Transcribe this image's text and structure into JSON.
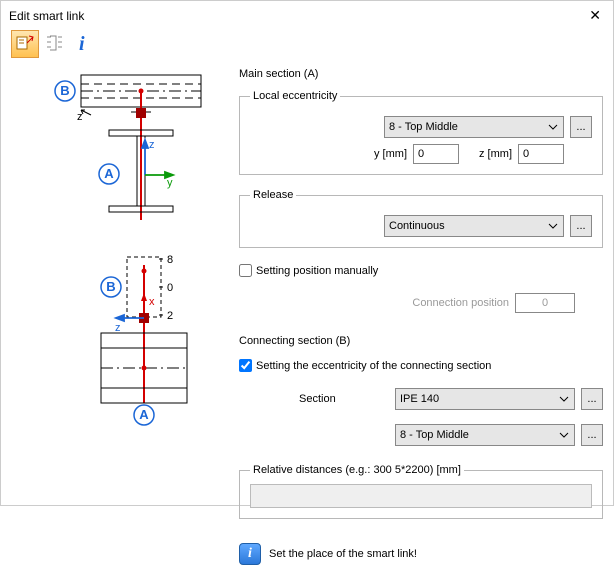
{
  "window": {
    "title": "Edit smart link"
  },
  "main_section": {
    "heading": "Main section (A)",
    "ecc_legend": "Local eccentricity",
    "ecc_select": "8 - Top Middle",
    "y_label": "y [mm]",
    "y_value": "0",
    "z_label": "z [mm]",
    "z_value": "0",
    "release_legend": "Release",
    "release_select": "Continuous",
    "manual_label": "Setting position manually",
    "conn_pos_label": "Connection position",
    "conn_pos_value": "0"
  },
  "conn_section": {
    "heading": "Connecting section (B)",
    "ecc_checkbox": "Setting the eccentricity of the connecting section",
    "section_label": "Section",
    "section_select": "IPE 140",
    "pos_select": "8 - Top Middle",
    "rel_legend": "Relative distances (e.g.: 300 5*2200) [mm]"
  },
  "hint": "Set the place of the smart link!",
  "diagram": {
    "labels": {
      "A": "A",
      "B": "B",
      "x": "x",
      "y": "y",
      "z": "z"
    },
    "ticks": {
      "t1": "8",
      "t2": "0",
      "t3": "2"
    }
  }
}
